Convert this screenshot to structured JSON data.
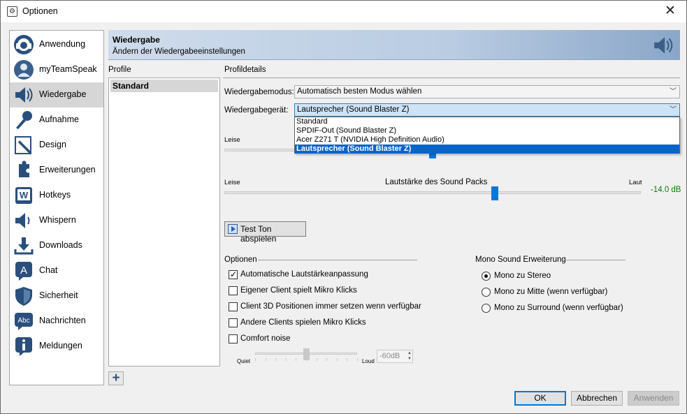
{
  "window": {
    "title": "Optionen",
    "close_symbol": "✕"
  },
  "sidebar": {
    "items": [
      {
        "label": "Anwendung",
        "icon": "headset-logo-icon"
      },
      {
        "label": "myTeamSpeak",
        "icon": "user-icon"
      },
      {
        "label": "Wiedergabe",
        "icon": "speaker-icon",
        "active": true
      },
      {
        "label": "Aufnahme",
        "icon": "microphone-icon"
      },
      {
        "label": "Design",
        "icon": "pencil-icon"
      },
      {
        "label": "Erweiterungen",
        "icon": "puzzle-icon"
      },
      {
        "label": "Hotkeys",
        "icon": "keyboard-w-icon"
      },
      {
        "label": "Whispern",
        "icon": "whisper-speaker-icon"
      },
      {
        "label": "Downloads",
        "icon": "download-icon"
      },
      {
        "label": "Chat",
        "icon": "chat-bubble-icon"
      },
      {
        "label": "Sicherheit",
        "icon": "shield-icon"
      },
      {
        "label": "Nachrichten",
        "icon": "abc-message-icon"
      },
      {
        "label": "Meldungen",
        "icon": "info-icon"
      }
    ]
  },
  "banner": {
    "title": "Wiedergabe",
    "subtitle": "Ändern der Wiedergabeeinstellungen"
  },
  "profiles": {
    "header": "Profile",
    "items": [
      "Standard"
    ],
    "add_symbol": "+"
  },
  "details": {
    "header": "Profildetails",
    "mode_label": "Wiedergabemodus:",
    "mode_value": "Automatisch besten Modus wählen",
    "device_label": "Wiedergabegerät:",
    "device_value": "Lautsprecher (Sound Blaster Z)",
    "device_options": [
      "Standard",
      "SPDIF-Out (Sound Blaster Z)",
      "Acer Z271 T (NVIDIA High Definition Audio)",
      "Lautsprecher (Sound Blaster Z)"
    ],
    "device_selected_index": 3,
    "volume_low_label": "Leise",
    "volume_fraction": 0.5,
    "soundpack": {
      "low": "Leise",
      "title": "Lautstärke des Sound Packs",
      "high": "Laut",
      "value": "-14.0 dB",
      "fraction": 0.65
    },
    "test_button": "Test Ton abspielen"
  },
  "options": {
    "header": "Optionen",
    "items": [
      {
        "label": "Automatische Lautstärkeanpassung",
        "checked": true
      },
      {
        "label": "Eigener Client spielt Mikro Klicks",
        "checked": false
      },
      {
        "label": "Client 3D Positionen immer setzen wenn verfügbar",
        "checked": false
      },
      {
        "label": "Andere Clients spielen Mikro Klicks",
        "checked": false
      },
      {
        "label": "Comfort noise",
        "checked": false
      }
    ],
    "noise": {
      "quiet": "Quiet",
      "loud": "Loud",
      "value": "-60dB",
      "fraction": 0.5
    }
  },
  "mono": {
    "header": "Mono Sound Erweiterung",
    "items": [
      {
        "label": "Mono zu Stereo",
        "checked": true
      },
      {
        "label": "Mono zu Mitte (wenn verfügbar)",
        "checked": false
      },
      {
        "label": "Mono zu Surround (wenn verfügbar)",
        "checked": false
      }
    ]
  },
  "footer": {
    "ok": "OK",
    "cancel": "Abbrechen",
    "apply": "Anwenden"
  },
  "colors": {
    "accent": "#0078d7",
    "selection": "#0a64c8",
    "db_value": "#0b7a0b"
  }
}
